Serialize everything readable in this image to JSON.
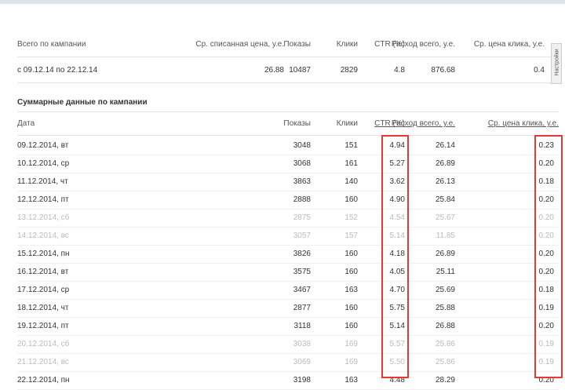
{
  "summary": {
    "headers": [
      "Всего по кампании",
      "Ср. списанная цена, у.е.",
      "Показы",
      "Клики",
      "CTR (%)",
      "Расход всего, у.е.",
      "Ср. цена клика, у.е."
    ],
    "row": [
      "с 09.12.14 по 22.12.14",
      "26.88",
      "10487",
      "2829",
      "4.8",
      "876.68",
      "0.4"
    ]
  },
  "settings_tab": "Настройки",
  "section_title": "Суммарные данные по кампании",
  "daily": {
    "headers": [
      "Дата",
      "Показы",
      "Клики",
      "CTR (%)",
      "Расход всего, у.е.",
      "Ср. цена клика, у.е."
    ],
    "rows": [
      [
        "09.12.2014, вт",
        "3048",
        "151",
        "4.94",
        "26.14",
        "0.23",
        false
      ],
      [
        "10.12.2014, ср",
        "3068",
        "161",
        "5.27",
        "26.89",
        "0.20",
        false
      ],
      [
        "11.12.2014, чт",
        "3863",
        "140",
        "3.62",
        "26.13",
        "0.18",
        false
      ],
      [
        "12.12.2014, пт",
        "2888",
        "160",
        "4.90",
        "25.84",
        "0.20",
        false
      ],
      [
        "13.12.2014, сб",
        "2875",
        "152",
        "4.54",
        "25.67",
        "0.20",
        true
      ],
      [
        "14.12.2014, вс",
        "3057",
        "157",
        "5.14",
        "11.85",
        "0.20",
        true
      ],
      [
        "15.12.2014, пн",
        "3826",
        "160",
        "4.18",
        "26.89",
        "0.20",
        false
      ],
      [
        "16.12.2014, вт",
        "3575",
        "160",
        "4.05",
        "25.11",
        "0.20",
        false
      ],
      [
        "17.12.2014, ср",
        "3467",
        "163",
        "4.70",
        "25.69",
        "0.18",
        false
      ],
      [
        "18.12.2014, чт",
        "2877",
        "160",
        "5.75",
        "25.88",
        "0.19",
        false
      ],
      [
        "19.12.2014, пт",
        "3118",
        "160",
        "5.14",
        "26.88",
        "0.20",
        false
      ],
      [
        "20.12.2014, сб",
        "3038",
        "169",
        "5.57",
        "25.86",
        "0.19",
        true
      ],
      [
        "21.12.2014, вс",
        "3069",
        "169",
        "5.50",
        "25.86",
        "0.19",
        true
      ],
      [
        "22.12.2014, пн",
        "3198",
        "163",
        "4.48",
        "28.29",
        "0.20",
        false
      ]
    ]
  }
}
